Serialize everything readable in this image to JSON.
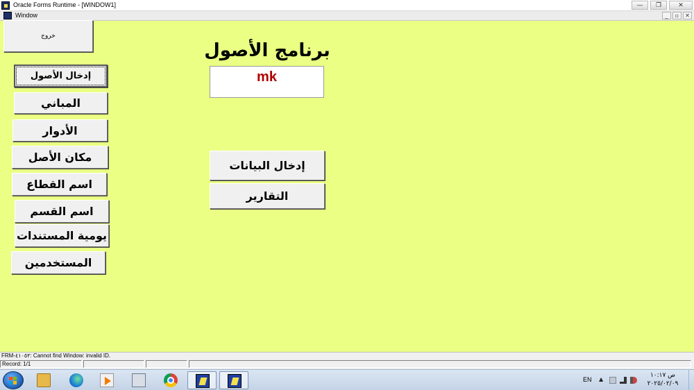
{
  "window": {
    "title": "Oracle Forms Runtime - [WINDOW1]",
    "mdi_title": "Window",
    "controls": [
      "—",
      "❐",
      "✕"
    ],
    "mdi_controls": [
      "_",
      "▫",
      "✕"
    ]
  },
  "form": {
    "heading": "برنامج الأصول",
    "user_field_value": "mk",
    "exit_label": "خروج",
    "menu": [
      {
        "name": "btn-enter-assets",
        "label": "إدخال الأصول"
      },
      {
        "name": "btn-buildings",
        "label": "المباني"
      },
      {
        "name": "btn-floors",
        "label": "الأدوار"
      },
      {
        "name": "btn-asset-location",
        "label": "مكان الأصل"
      },
      {
        "name": "btn-sector-name",
        "label": "اسم القطاع"
      },
      {
        "name": "btn-department-name",
        "label": "اسم القسم"
      },
      {
        "name": "btn-documents-journal",
        "label": "يومية المستندات"
      },
      {
        "name": "btn-users",
        "label": "المستخدمين"
      }
    ],
    "data_entry_label": "إدخال البيانات",
    "reports_label": "التقارير"
  },
  "status": {
    "message": "FRM-٤١٠٥٢: Cannot find Window: invalid ID.",
    "record": "Record: 1/1"
  },
  "taskbar": {
    "apps": [
      "start-orb-icon",
      "file-explorer-icon",
      "edge-icon",
      "media-player-icon",
      "calculator-icon",
      "chrome-icon",
      "oracle-forms-icon",
      "oracle-forms-icon"
    ],
    "language": "EN",
    "tray_arrow": "▲",
    "clock_time": "ص ١٠:١٧",
    "clock_date": "٢٠٢٥/٠٢/٠٩"
  },
  "colors": {
    "canvas": "#eaff83",
    "user_value": "#b00000",
    "button": "#f0f0f0"
  }
}
